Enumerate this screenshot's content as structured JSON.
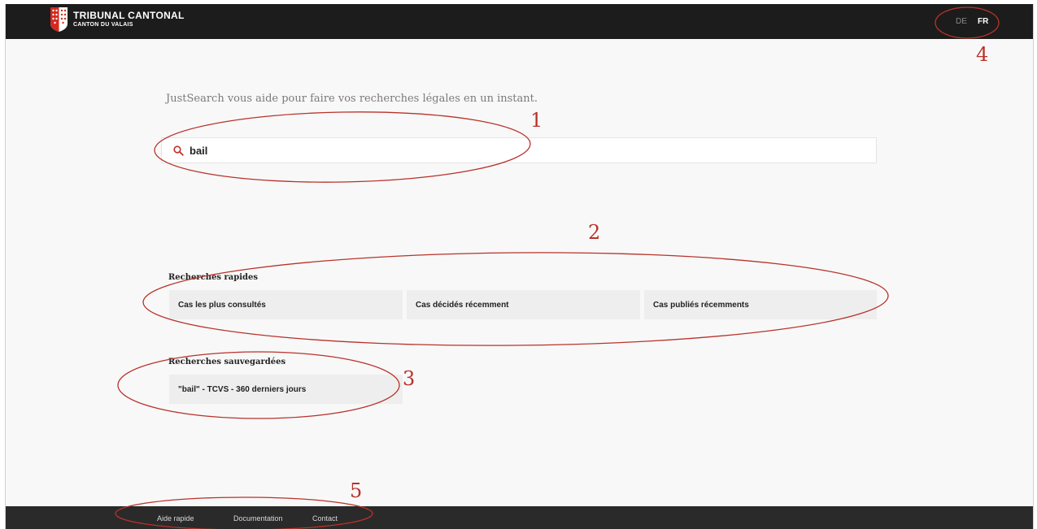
{
  "header": {
    "logo_title": "TRIBUNAL CANTONAL",
    "logo_subtitle": "CANTON DU VALAIS",
    "languages": [
      {
        "label": "DE",
        "active": false
      },
      {
        "label": "FR",
        "active": true
      }
    ]
  },
  "main": {
    "tagline": "JustSearch vous aide pour faire vos recherches légales en un instant.",
    "search": {
      "value": "bail",
      "icon": "search-icon"
    },
    "quick_searches": {
      "title": "Recherches rapides",
      "items": [
        "Cas les plus consultés",
        "Cas décidés récemment",
        "Cas publiés récemments"
      ]
    },
    "saved_searches": {
      "title": "Recherches sauvegardées",
      "items": [
        "\"bail\" - TCVS - 360 derniers jours"
      ]
    }
  },
  "footer": {
    "links": [
      "Aide rapide",
      "Documentation",
      "Contact"
    ]
  },
  "annotations": {
    "labels": [
      "1",
      "2",
      "3",
      "4",
      "5"
    ],
    "color": "#b8322a"
  },
  "colors": {
    "header_bg": "#1c1c1c",
    "footer_bg": "#2a2a2a",
    "page_bg": "#f8f8f8",
    "card_bg": "#eeeeee",
    "accent_red": "#c0302a"
  }
}
